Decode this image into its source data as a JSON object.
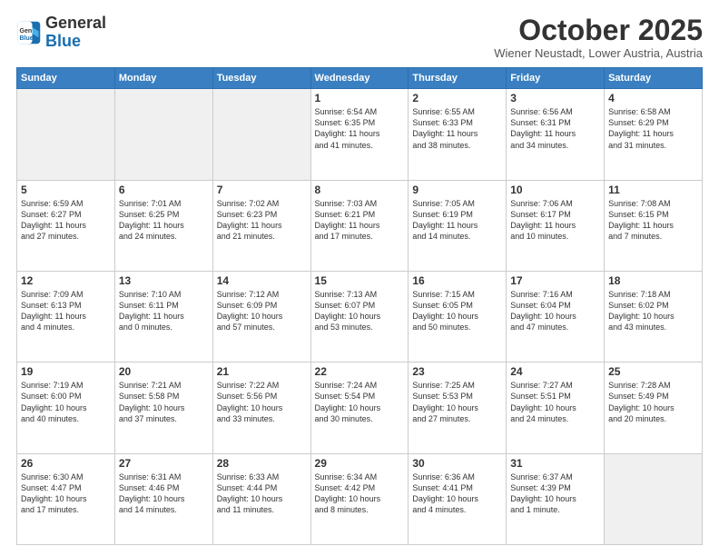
{
  "logo": {
    "line1": "General",
    "line2": "Blue"
  },
  "title": "October 2025",
  "subtitle": "Wiener Neustadt, Lower Austria, Austria",
  "days_of_week": [
    "Sunday",
    "Monday",
    "Tuesday",
    "Wednesday",
    "Thursday",
    "Friday",
    "Saturday"
  ],
  "weeks": [
    [
      {
        "num": "",
        "info": ""
      },
      {
        "num": "",
        "info": ""
      },
      {
        "num": "",
        "info": ""
      },
      {
        "num": "1",
        "info": "Sunrise: 6:54 AM\nSunset: 6:35 PM\nDaylight: 11 hours\nand 41 minutes."
      },
      {
        "num": "2",
        "info": "Sunrise: 6:55 AM\nSunset: 6:33 PM\nDaylight: 11 hours\nand 38 minutes."
      },
      {
        "num": "3",
        "info": "Sunrise: 6:56 AM\nSunset: 6:31 PM\nDaylight: 11 hours\nand 34 minutes."
      },
      {
        "num": "4",
        "info": "Sunrise: 6:58 AM\nSunset: 6:29 PM\nDaylight: 11 hours\nand 31 minutes."
      }
    ],
    [
      {
        "num": "5",
        "info": "Sunrise: 6:59 AM\nSunset: 6:27 PM\nDaylight: 11 hours\nand 27 minutes."
      },
      {
        "num": "6",
        "info": "Sunrise: 7:01 AM\nSunset: 6:25 PM\nDaylight: 11 hours\nand 24 minutes."
      },
      {
        "num": "7",
        "info": "Sunrise: 7:02 AM\nSunset: 6:23 PM\nDaylight: 11 hours\nand 21 minutes."
      },
      {
        "num": "8",
        "info": "Sunrise: 7:03 AM\nSunset: 6:21 PM\nDaylight: 11 hours\nand 17 minutes."
      },
      {
        "num": "9",
        "info": "Sunrise: 7:05 AM\nSunset: 6:19 PM\nDaylight: 11 hours\nand 14 minutes."
      },
      {
        "num": "10",
        "info": "Sunrise: 7:06 AM\nSunset: 6:17 PM\nDaylight: 11 hours\nand 10 minutes."
      },
      {
        "num": "11",
        "info": "Sunrise: 7:08 AM\nSunset: 6:15 PM\nDaylight: 11 hours\nand 7 minutes."
      }
    ],
    [
      {
        "num": "12",
        "info": "Sunrise: 7:09 AM\nSunset: 6:13 PM\nDaylight: 11 hours\nand 4 minutes."
      },
      {
        "num": "13",
        "info": "Sunrise: 7:10 AM\nSunset: 6:11 PM\nDaylight: 11 hours\nand 0 minutes."
      },
      {
        "num": "14",
        "info": "Sunrise: 7:12 AM\nSunset: 6:09 PM\nDaylight: 10 hours\nand 57 minutes."
      },
      {
        "num": "15",
        "info": "Sunrise: 7:13 AM\nSunset: 6:07 PM\nDaylight: 10 hours\nand 53 minutes."
      },
      {
        "num": "16",
        "info": "Sunrise: 7:15 AM\nSunset: 6:05 PM\nDaylight: 10 hours\nand 50 minutes."
      },
      {
        "num": "17",
        "info": "Sunrise: 7:16 AM\nSunset: 6:04 PM\nDaylight: 10 hours\nand 47 minutes."
      },
      {
        "num": "18",
        "info": "Sunrise: 7:18 AM\nSunset: 6:02 PM\nDaylight: 10 hours\nand 43 minutes."
      }
    ],
    [
      {
        "num": "19",
        "info": "Sunrise: 7:19 AM\nSunset: 6:00 PM\nDaylight: 10 hours\nand 40 minutes."
      },
      {
        "num": "20",
        "info": "Sunrise: 7:21 AM\nSunset: 5:58 PM\nDaylight: 10 hours\nand 37 minutes."
      },
      {
        "num": "21",
        "info": "Sunrise: 7:22 AM\nSunset: 5:56 PM\nDaylight: 10 hours\nand 33 minutes."
      },
      {
        "num": "22",
        "info": "Sunrise: 7:24 AM\nSunset: 5:54 PM\nDaylight: 10 hours\nand 30 minutes."
      },
      {
        "num": "23",
        "info": "Sunrise: 7:25 AM\nSunset: 5:53 PM\nDaylight: 10 hours\nand 27 minutes."
      },
      {
        "num": "24",
        "info": "Sunrise: 7:27 AM\nSunset: 5:51 PM\nDaylight: 10 hours\nand 24 minutes."
      },
      {
        "num": "25",
        "info": "Sunrise: 7:28 AM\nSunset: 5:49 PM\nDaylight: 10 hours\nand 20 minutes."
      }
    ],
    [
      {
        "num": "26",
        "info": "Sunrise: 6:30 AM\nSunset: 4:47 PM\nDaylight: 10 hours\nand 17 minutes."
      },
      {
        "num": "27",
        "info": "Sunrise: 6:31 AM\nSunset: 4:46 PM\nDaylight: 10 hours\nand 14 minutes."
      },
      {
        "num": "28",
        "info": "Sunrise: 6:33 AM\nSunset: 4:44 PM\nDaylight: 10 hours\nand 11 minutes."
      },
      {
        "num": "29",
        "info": "Sunrise: 6:34 AM\nSunset: 4:42 PM\nDaylight: 10 hours\nand 8 minutes."
      },
      {
        "num": "30",
        "info": "Sunrise: 6:36 AM\nSunset: 4:41 PM\nDaylight: 10 hours\nand 4 minutes."
      },
      {
        "num": "31",
        "info": "Sunrise: 6:37 AM\nSunset: 4:39 PM\nDaylight: 10 hours\nand 1 minute."
      },
      {
        "num": "",
        "info": ""
      }
    ]
  ]
}
